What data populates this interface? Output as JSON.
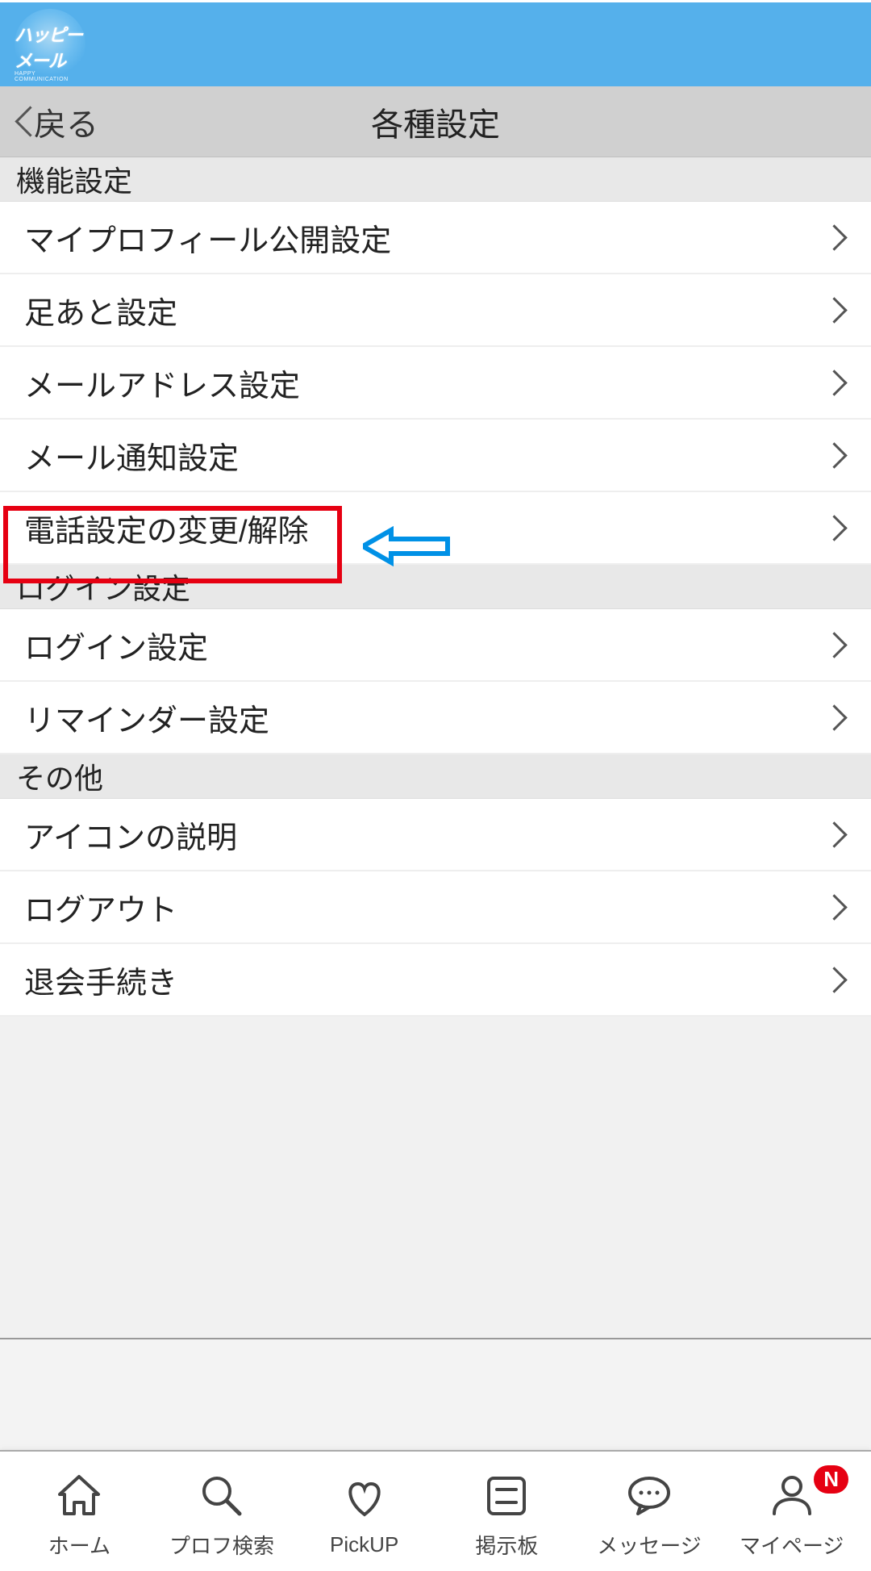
{
  "logo": {
    "main_text": "ハッピーメール",
    "sub_text": "HAPPY COMMUNICATION"
  },
  "nav_header": {
    "back_label": "戻る",
    "title": "各種設定"
  },
  "sections": {
    "function": {
      "header": "機能設定",
      "items": [
        "マイプロフィール公開設定",
        "足あと設定",
        "メールアドレス設定",
        "メール通知設定",
        "電話設定の変更/解除"
      ]
    },
    "login": {
      "header": "ログイン設定",
      "items": [
        "ログイン設定",
        "リマインダー設定"
      ]
    },
    "other": {
      "header": "その他",
      "items": [
        "アイコンの説明",
        "ログアウト",
        "退会手続き"
      ]
    }
  },
  "annotation": {
    "highlight_target_index": 3
  },
  "bottom_nav": {
    "items": [
      {
        "label": "ホーム",
        "icon": "home-icon"
      },
      {
        "label": "プロフ検索",
        "icon": "search-icon"
      },
      {
        "label": "PickUP",
        "icon": "heart-icon"
      },
      {
        "label": "掲示板",
        "icon": "board-icon"
      },
      {
        "label": "メッセージ",
        "icon": "message-icon"
      },
      {
        "label": "マイページ",
        "icon": "person-icon",
        "badge": "N"
      }
    ]
  }
}
